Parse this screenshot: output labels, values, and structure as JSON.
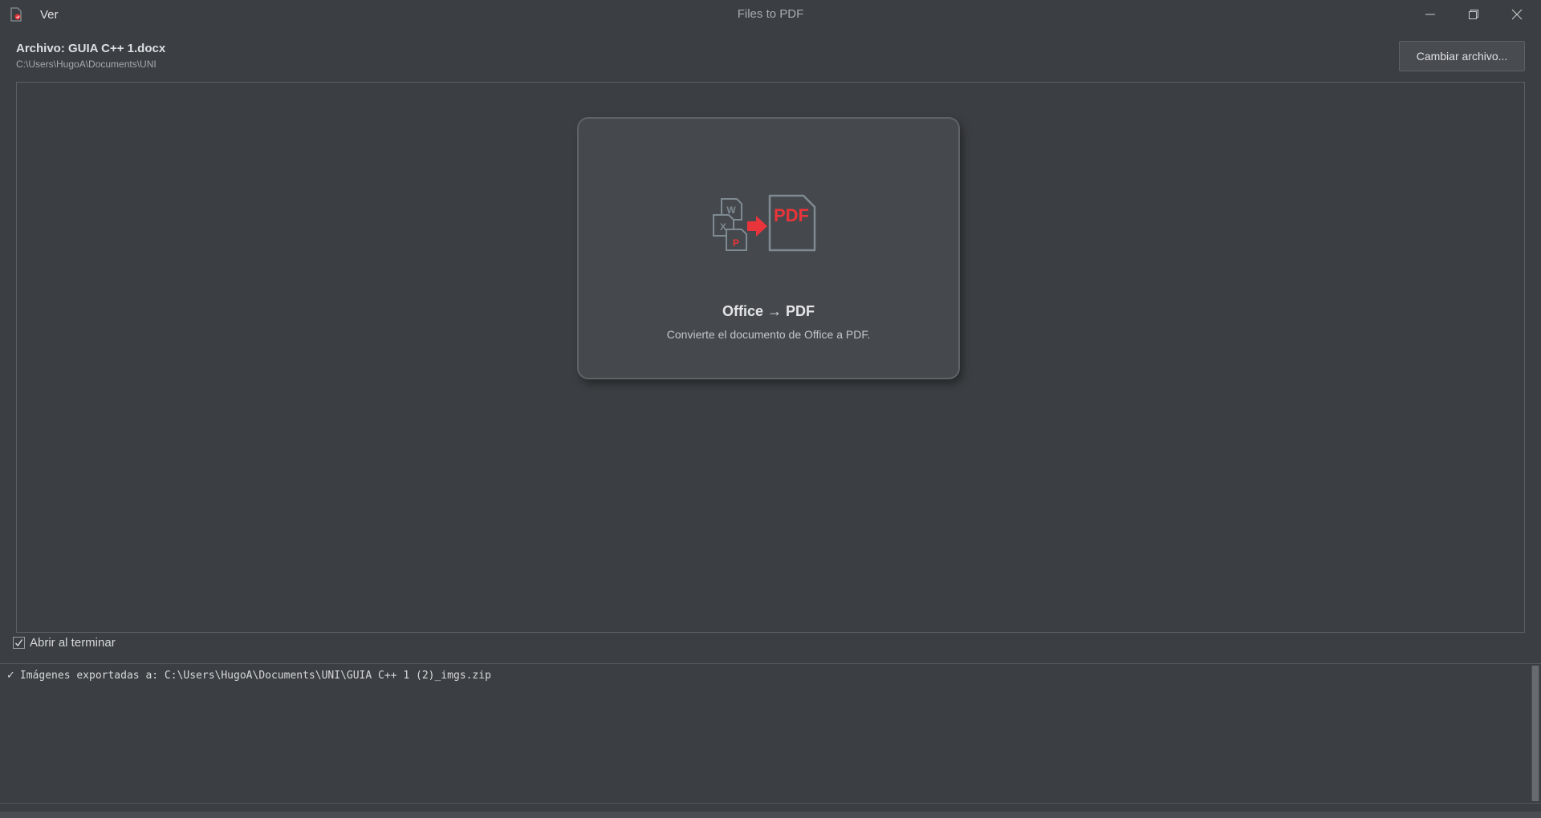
{
  "titlebar": {
    "app_icon": "pdf-app-icon",
    "menu": [
      {
        "label": "Ver"
      }
    ],
    "title": "Files to PDF",
    "controls": [
      "minimize-icon",
      "restore-icon",
      "close-icon"
    ]
  },
  "file": {
    "title": "Archivo: GUIA C++ 1.docx",
    "path": "C:\\Users\\HugoA\\Documents\\UNI",
    "change_button": "Cambiar archivo..."
  },
  "conversion_card": {
    "icon": "office-to-pdf-icon",
    "icon_labels": {
      "word": "W",
      "excel": "X",
      "powerpoint": "P",
      "pdf": "PDF"
    },
    "title": "Office → PDF",
    "description": "Convierte el documento de Office a PDF."
  },
  "options": {
    "open_when_done": {
      "label": "Abrir al terminar",
      "checked": true
    }
  },
  "log": {
    "lines": [
      {
        "icon": "✓",
        "text": "Imágenes exportadas a: C:\\Users\\HugoA\\Documents\\UNI\\GUIA C++ 1 (2)_imgs.zip"
      }
    ]
  },
  "colors": {
    "background": "#3b3f43",
    "card": "#45494d",
    "accent_red": "#e8343a",
    "icon_gray": "#7f8a92"
  }
}
